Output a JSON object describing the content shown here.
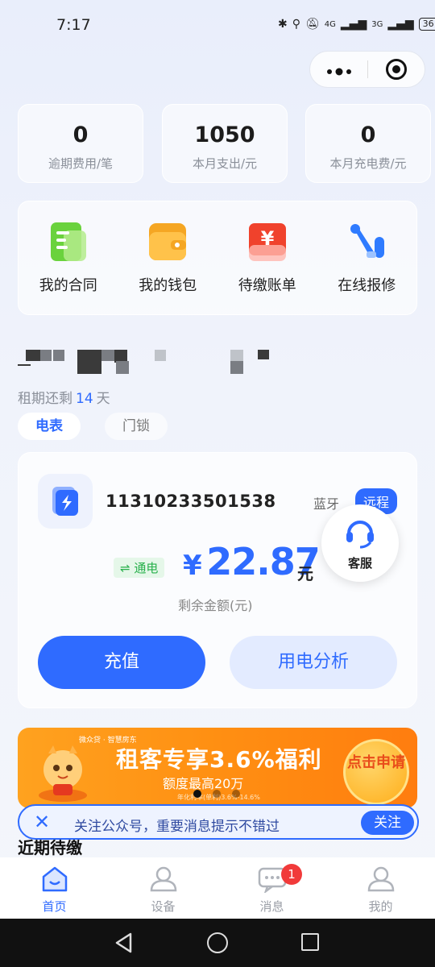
{
  "status_bar": {
    "time": "7:17",
    "network_a": "4G",
    "network_b": "3G",
    "battery": "36"
  },
  "capsule": {
    "more_label": "•●•"
  },
  "stats": [
    {
      "value": "0",
      "label": "逾期费用/笔"
    },
    {
      "value": "1050",
      "label": "本月支出/元"
    },
    {
      "value": "0",
      "label": "本月充电费/元"
    }
  ],
  "menu": [
    {
      "label": "我的合同",
      "icon": "contract-icon"
    },
    {
      "label": "我的钱包",
      "icon": "wallet-icon"
    },
    {
      "label": "待缴账单",
      "icon": "bill-icon"
    },
    {
      "label": "在线报修",
      "icon": "repair-icon"
    }
  ],
  "lease": {
    "prefix": "租期还剩",
    "days": "14",
    "suffix": "天"
  },
  "segments": {
    "active": "电表",
    "inactive": "门锁"
  },
  "meter": {
    "number": "11310233501538",
    "tag_bluetooth": "蓝牙",
    "tag_remote": "远程",
    "power_status": "⇌ 通电",
    "currency": "¥",
    "balance": "22.87",
    "unit": "元",
    "balance_label": "剩余金额(元)",
    "recharge_label": "充值",
    "analysis_label": "用电分析"
  },
  "customer_service": {
    "label": "客服"
  },
  "banner": {
    "brand": "微众贷 · 智慧房东",
    "title": "租客专享3.6%福利",
    "subtitle": "额度最高20万",
    "fine_print": "年化利率(单利)3.6%-14.6%",
    "button": "点击申请",
    "active_slide": 0
  },
  "follow_bar": {
    "close": "✕",
    "text": "关注公众号，重要消息提示不错过",
    "button": "关注"
  },
  "recent": {
    "title": "近期待缴"
  },
  "tabbar": [
    {
      "label": "首页",
      "icon": "home-icon",
      "active": true
    },
    {
      "label": "设备",
      "icon": "device-icon",
      "active": false
    },
    {
      "label": "消息",
      "icon": "message-icon",
      "active": false,
      "badge": "1"
    },
    {
      "label": "我的",
      "icon": "profile-icon",
      "active": false
    }
  ],
  "colors": {
    "accent": "#2f6bff",
    "green": "#27b04b",
    "orange": "#ff8f12",
    "badge": "#f13a3a"
  }
}
